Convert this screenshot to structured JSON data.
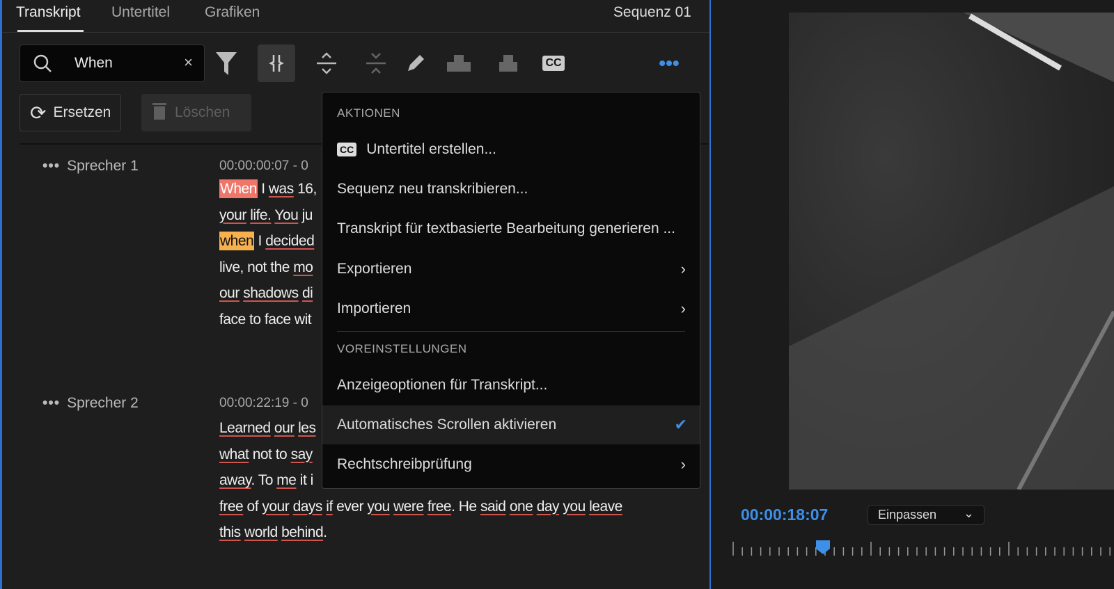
{
  "tabs": [
    "Transkript",
    "Untertitel",
    "Grafiken"
  ],
  "sequence": "Sequenz 01",
  "search": {
    "value": "When",
    "clear": "×"
  },
  "buttons": {
    "replace": "Ersetzen",
    "delete": "Löschen"
  },
  "transcript": [
    {
      "speaker": "Sprecher 1",
      "timecode": "00:00:00:07 - 0",
      "lines": [
        [
          {
            "t": "When",
            "h": 1
          },
          " ",
          {
            "t": "I",
            "u": 0
          },
          " ",
          {
            "t": "was",
            "u": 1
          },
          " 16, "
        ],
        [
          {
            "t": "your",
            "u": 1
          },
          " ",
          {
            "t": "life.",
            "u": 1
          },
          " ",
          {
            "t": "You",
            "u": 1
          },
          " ju"
        ],
        [
          {
            "t": "when",
            "h": 2
          },
          " I ",
          {
            "t": "decided",
            "u": 1
          }
        ],
        [
          "live, not the ",
          {
            "t": "mo",
            "u": 1
          }
        ],
        [
          {
            "t": "our",
            "u": 1
          },
          " ",
          {
            "t": "shadows",
            "u": 1
          },
          " ",
          {
            "t": "di",
            "u": 1
          }
        ],
        [
          "face to face wit"
        ]
      ]
    },
    {
      "speaker": "Sprecher 2",
      "timecode": "00:00:22:19 - 0",
      "lines": [
        [
          {
            "t": "Learned",
            "u": 1
          },
          " ",
          {
            "t": "our",
            "u": 1
          },
          " ",
          {
            "t": "les",
            "u": 1
          }
        ],
        [
          {
            "t": "what",
            "u": 1
          },
          " not to ",
          {
            "t": "say",
            "u": 1
          }
        ],
        [
          {
            "t": "away",
            "u": 1
          },
          ". To ",
          {
            "t": "me",
            "u": 1
          },
          " it i"
        ],
        [
          {
            "t": "free",
            "u": 1
          },
          " of ",
          {
            "t": "your",
            "u": 1
          },
          " ",
          {
            "t": "days",
            "u": 1
          },
          " ",
          {
            "t": "if",
            "u": 1
          },
          " ever ",
          {
            "t": "you",
            "u": 1
          },
          " ",
          {
            "t": "were",
            "u": 1
          },
          " ",
          {
            "t": "free",
            "u": 1
          },
          ". He ",
          {
            "t": "said",
            "u": 1
          },
          " ",
          {
            "t": "one",
            "u": 1
          },
          " ",
          {
            "t": "day",
            "u": 1
          },
          " ",
          {
            "t": "you",
            "u": 1
          },
          " ",
          {
            "t": "leave",
            "u": 1
          }
        ],
        [
          {
            "t": "this",
            "u": 1
          },
          " ",
          {
            "t": "world",
            "u": 1
          },
          " ",
          {
            "t": "behind",
            "u": 1
          },
          "."
        ]
      ]
    }
  ],
  "menu": {
    "section1": "AKTIONEN",
    "section2": "VOREINSTELLUNGEN",
    "cc_icon": "CC",
    "items": [
      "Untertitel erstellen...",
      "Sequenz neu transkribieren...",
      "Transkript für textbasierte Bearbeitung generieren ...",
      "Exportieren",
      "Importieren",
      "Anzeigeoptionen für Transkript...",
      "Automatisches Scrollen aktivieren",
      "Rechtschreibprüfung"
    ]
  },
  "monitor": {
    "timecode": "00:00:18:07",
    "zoom": "Einpassen",
    "playhead_fraction": 0.24
  },
  "colors": {
    "accent": "#3d8fe8",
    "search_hit": "#f0766a",
    "current_hit": "#f6b04e"
  }
}
